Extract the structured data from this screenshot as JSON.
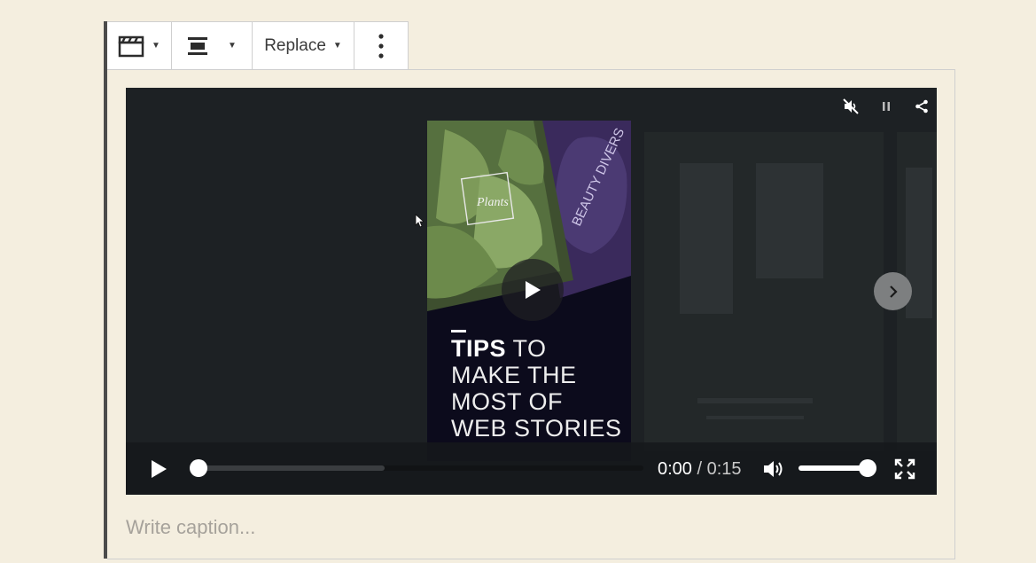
{
  "toolbar": {
    "media_icon": "film-clapper-icon",
    "align_icon": "align-center-icon",
    "replace_label": "Replace",
    "more_icon": "vertical-ellipsis-icon"
  },
  "player": {
    "top_icons": [
      "volume-muted-icon",
      "pause-icon",
      "share-icon"
    ],
    "story": {
      "title_bold": "TIPS",
      "title_rest_1": " TO",
      "title_line_2": "MAKE THE",
      "title_line_3": "MOST OF",
      "title_line_4": "WEB STORIES",
      "plants_label": "Plants",
      "beauty_label": "BEAUTY DIVERS"
    },
    "controls": {
      "current_time": "0:00",
      "separator": " / ",
      "duration": "0:15",
      "progress": 0,
      "volume": 1
    }
  },
  "caption": {
    "placeholder": "Write caption..."
  },
  "colors": {
    "page_bg": "#f4eedf",
    "player_bg": "#1d2124",
    "accent_bar": "#4b4b4b"
  }
}
